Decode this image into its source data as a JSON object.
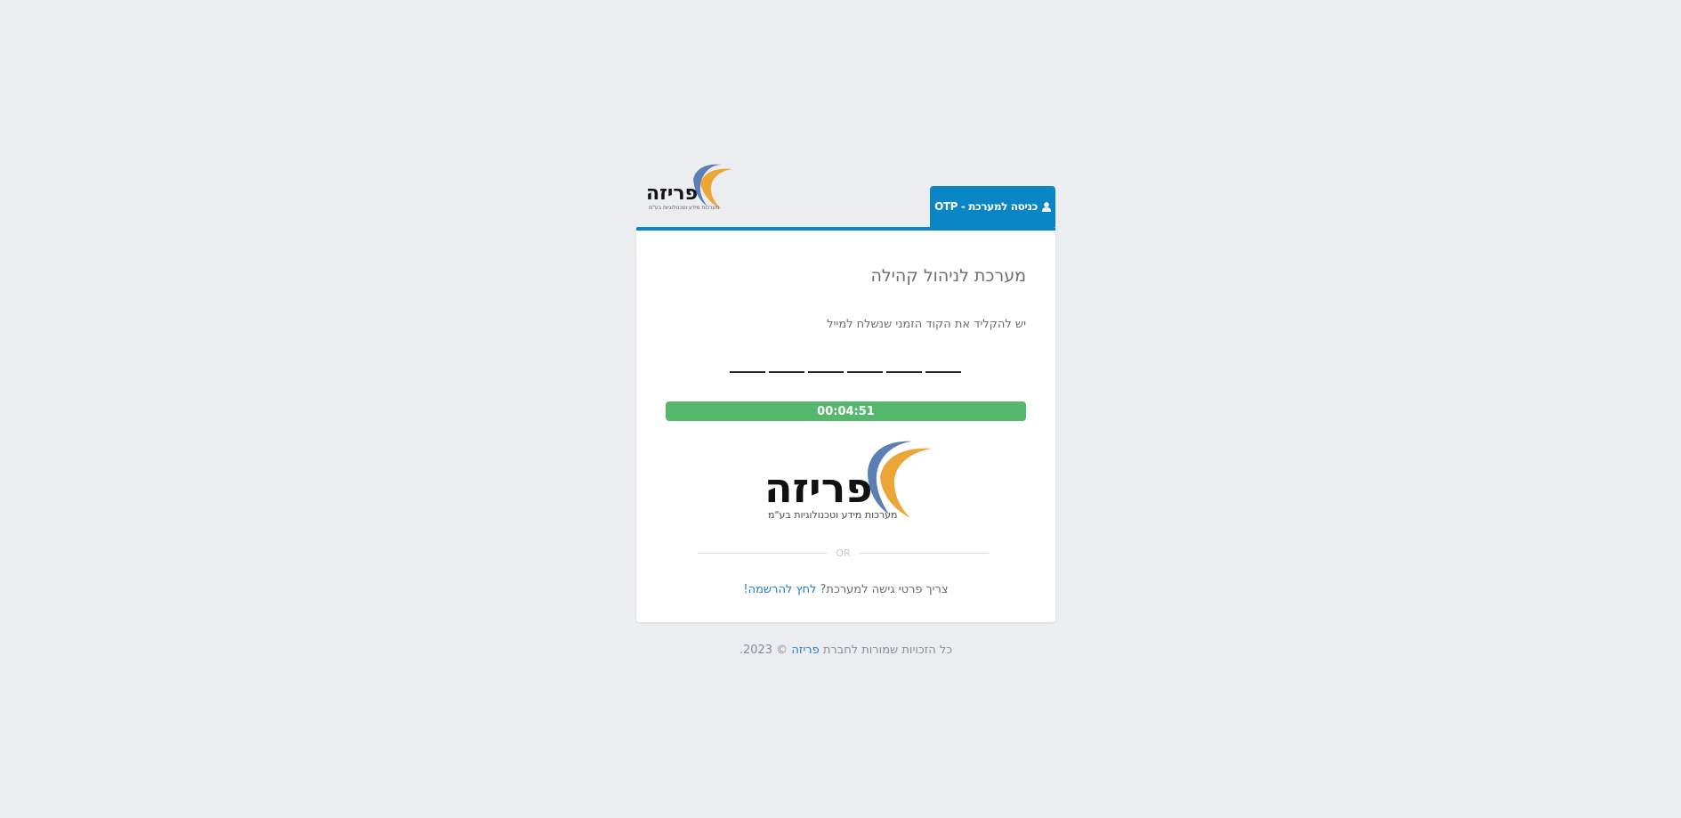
{
  "header": {
    "logo_name": "פריזה",
    "logo_tagline": "מערכות מידע וטכנולוגיות בע\"מ",
    "tab_label": "כניסה למערכת - OTP"
  },
  "panel": {
    "title": "מערכת לניהול קהילה",
    "instruction": "יש להקליד את הקוד הזמני שנשלח למייל",
    "otp_digits": [
      "",
      "",
      "",
      "",
      "",
      ""
    ],
    "timer": "00:04:51",
    "logo_name": "פריזה",
    "logo_tagline": "מערכות מידע וטכנולוגיות בע\"מ",
    "or_text": "OR",
    "register_prompt": "צריך פרטי גישה למערכת?",
    "register_link": "לחץ להרשמה!"
  },
  "footer": {
    "prefix": "כל הזכויות שמורות לחברת",
    "company_link": "פריזה",
    "suffix": "© 2023."
  },
  "colors": {
    "accent": "#0a86c6",
    "timer": "#56b86c",
    "link": "#1f7fc4",
    "background": "#ecedf1",
    "logo_blue": "#5b7fb5",
    "logo_orange": "#eba637"
  },
  "icons": {
    "tab_icon": "user-icon"
  }
}
